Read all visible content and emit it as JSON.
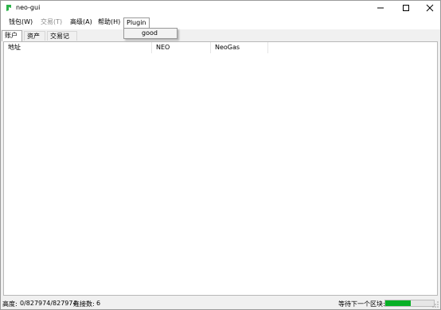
{
  "window": {
    "title": "neo-gui",
    "minimize_glyph": "—",
    "maximize_glyph": "☐",
    "close_glyph": "✕"
  },
  "menu": {
    "items": [
      {
        "label": "钱包(W)",
        "enabled": true
      },
      {
        "label": "交易(T)",
        "enabled": false
      },
      {
        "label": "高级(A)",
        "enabled": true
      },
      {
        "label": "帮助(H)",
        "enabled": true
      },
      {
        "label": "Plugin",
        "enabled": true,
        "open": true
      }
    ],
    "plugin_dropdown": [
      "good"
    ]
  },
  "tabs": [
    {
      "label": "账户",
      "active": true
    },
    {
      "label": "资产",
      "active": false
    },
    {
      "label": "交易记录",
      "active": false
    }
  ],
  "table": {
    "columns": [
      "地址",
      "NEO",
      "NeoGas"
    ],
    "rows": []
  },
  "status": {
    "height_label": "高度:",
    "height_value": "0/827974/827974",
    "connections_label": "连接数:",
    "connections_value": "6",
    "waiting_label": "等待下一个区块:",
    "progress_fraction": 0.52,
    "progress_color": "#06b025"
  },
  "colors": {
    "app_icon": "#2db34a",
    "disabled_text": "#8a8a8a"
  }
}
